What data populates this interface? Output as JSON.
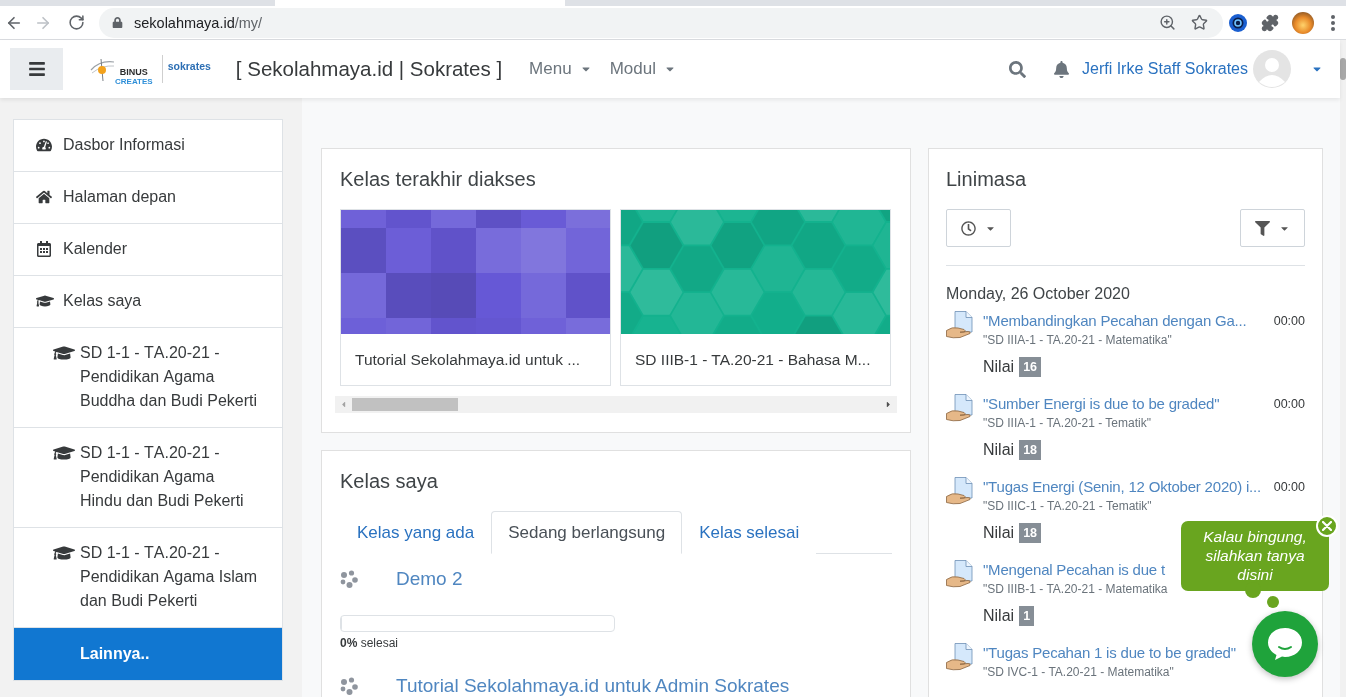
{
  "browser": {
    "back": {
      "disabled": false
    },
    "forward": {
      "disabled": true
    },
    "url_host": "sekolahmaya.id",
    "url_path": "/my/"
  },
  "navbar": {
    "logo": {
      "top": "BINUS",
      "bottom": "CREATES",
      "brand": "sokrates"
    },
    "site_title": "[ Sekolahmaya.id | Sokrates ]",
    "menus": [
      {
        "label": "Menu"
      },
      {
        "label": "Modul"
      }
    ],
    "user_name": "Jerfi Irke Staff Sokrates"
  },
  "sidebar": {
    "items": [
      {
        "label": "Dasbor Informasi"
      },
      {
        "label": "Halaman depan"
      },
      {
        "label": "Kalender"
      },
      {
        "label": "Kelas saya",
        "children": [
          {
            "kind": "course",
            "label": "SD 1-1 - TA.20-21 - Pendidikan Agama Buddha dan Budi Pekerti"
          },
          {
            "kind": "course",
            "label": "SD 1-1 - TA.20-21 - Pendidikan Agama Hindu dan Budi Pekerti"
          },
          {
            "kind": "course",
            "label": "SD 1-1 - TA.20-21 - Pendidikan Agama Islam dan Budi Pekerti"
          },
          {
            "kind": "more",
            "label": "Lainnya.."
          }
        ]
      }
    ]
  },
  "recent_courses": {
    "title": "Kelas terakhir diakses",
    "courses": [
      {
        "kind": "squares",
        "color": "#6658d6",
        "name": "Tutorial Sekolahmaya.id untuk ..."
      },
      {
        "kind": "hexagons",
        "color": "#13b28e",
        "name": "SD IIIB-1 - TA.20-21 - Bahasa M..."
      }
    ]
  },
  "my_courses": {
    "title": "Kelas saya",
    "tabs": [
      {
        "label": "Kelas yang ada",
        "selected": false
      },
      {
        "label": "Sedang berlangsung",
        "selected": true
      },
      {
        "label": "Kelas selesai",
        "selected": false
      }
    ],
    "courses": [
      {
        "name": "Demo 2",
        "progress": {
          "level": 0,
          "reading": "**0%** selesai"
        }
      },
      {
        "name": "Tutorial Sekolahmaya.id untuk Admin Sokrates"
      }
    ]
  },
  "timeline": {
    "title": "Linimasa",
    "date": "Monday, 26 October 2020",
    "events": [
      {
        "title": "\"Membandingkan Pecahan dengan Ga...",
        "time": "00:00",
        "course": "\"SD IIIA-1 - TA.20-21 - Matematika\"",
        "grade_label": "Nilai",
        "grade": "16"
      },
      {
        "title": "\"Sumber Energi is due to be graded\"",
        "time": "00:00",
        "course": "\"SD IIIA-1 - TA.20-21 - Tematik\"",
        "grade_label": "Nilai",
        "grade": "18"
      },
      {
        "title": "\"Tugas Energi (Senin, 12 Oktober 2020) i...",
        "time": "00:00",
        "course": "\"SD IIIC-1 - TA.20-21 - Tematik\"",
        "grade_label": "Nilai",
        "grade": "18"
      },
      {
        "title": "\"Mengenal Pecahan is due t",
        "course": "\"SD IIIB-1 - TA.20-21 - Matematika",
        "grade_label": "Nilai",
        "grade": "1"
      },
      {
        "title": "\"Tugas Pecahan 1 is due to be graded\"",
        "course": "\"SD IVC-1 - TA.20-21 - Matematika\""
      }
    ]
  },
  "chat": {
    "message": "Kalau bingung, silahkan tanya disini"
  }
}
